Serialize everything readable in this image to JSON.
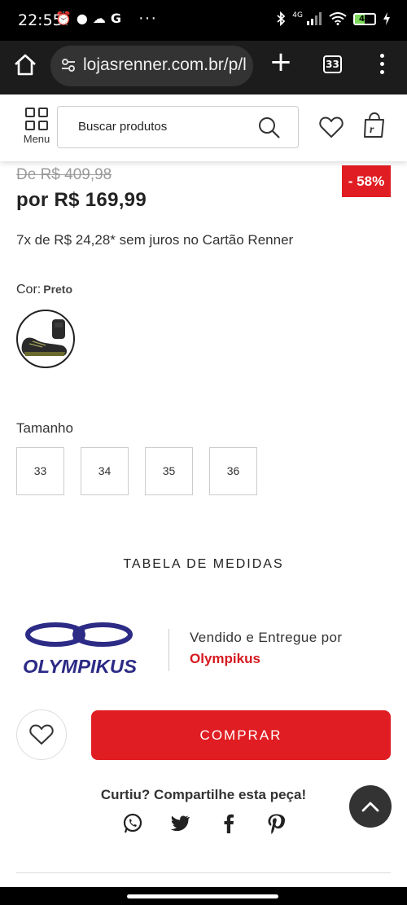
{
  "status_bar": {
    "time": "22:55",
    "left_icons": [
      "alarm-icon",
      "chat-icon",
      "cloud-icon",
      "google-icon"
    ],
    "network": "4G",
    "battery": "48"
  },
  "browser": {
    "url": "lojasrenner.com.br/p/l",
    "tab_count": "33"
  },
  "site_header": {
    "menu_label": "Menu",
    "search_placeholder": "Buscar  produtos"
  },
  "product": {
    "old_price": "De R$ 409,98",
    "discount": "- 58%",
    "price": "por R$ 169,99",
    "installments": "7x de R$ 24,28* sem juros no Cartão Renner",
    "color_label": "Cor:",
    "color_value": "Preto",
    "size_label": "Tamanho",
    "sizes": [
      "33",
      "34",
      "35",
      "36"
    ],
    "size_chart": "TABELA DE MEDIDAS"
  },
  "seller": {
    "logo_text": "OLYMPIKUS",
    "sold_by": "Vendido e Entregue por",
    "name": "Olympikus"
  },
  "actions": {
    "buy": "COMPRAR"
  },
  "share": {
    "title": "Curtiu? Compartilhe esta peça!",
    "networks": [
      "whatsapp-icon",
      "twitter-icon",
      "facebook-icon",
      "pinterest-icon"
    ]
  },
  "colors": {
    "accent": "#e01d22",
    "seller_name": "#d71920",
    "logo_blue": "#2c2b86"
  }
}
